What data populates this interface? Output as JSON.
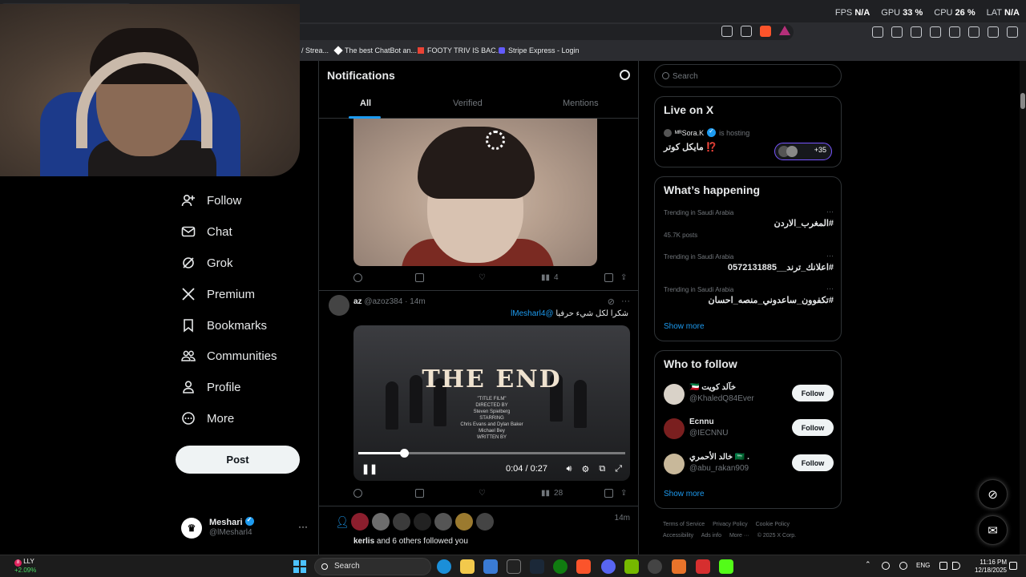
{
  "overlay": {
    "fps_label": "FPS",
    "fps_value": "N/A",
    "gpu_label": "GPU",
    "gpu_value": "33 %",
    "cpu_label": "CPU",
    "cpu_value": "26 %",
    "lat_label": "LAT",
    "lat_value": "N/A"
  },
  "bookmarks": [
    {
      "label": "/ Strea..."
    },
    {
      "label": "The best ChatBot an..."
    },
    {
      "label": "FOOTY TRIV IS BAC..."
    },
    {
      "label": "Stripe Express - Login"
    }
  ],
  "nav": {
    "items": [
      {
        "label": "Follow",
        "icon": "person-plus-icon"
      },
      {
        "label": "Chat",
        "icon": "mail-icon"
      },
      {
        "label": "Grok",
        "icon": "grok-icon"
      },
      {
        "label": "Premium",
        "icon": "x-logo-icon"
      },
      {
        "label": "Bookmarks",
        "icon": "bookmark-icon"
      },
      {
        "label": "Communities",
        "icon": "people-icon"
      },
      {
        "label": "Profile",
        "icon": "person-icon"
      },
      {
        "label": "More",
        "icon": "more-circle-icon"
      }
    ],
    "post_label": "Post"
  },
  "account": {
    "name": "Meshari",
    "handle": "@lMesharl4",
    "more": "···"
  },
  "notifications": {
    "title": "Notifications",
    "tabs": [
      "All",
      "Verified",
      "Mentions"
    ],
    "post1": {
      "views": "4"
    },
    "tweet": {
      "name": "az",
      "handle": "@azoz384",
      "time": "14m",
      "text": "شكرا لكل شيء حرفيا",
      "mention": "@lMesharl4",
      "video_title": "THE END",
      "video_credits": [
        "\"TITLE FILM\"",
        "DIRECTED BY",
        "Steven Spielberg",
        "STARRING",
        "Chris Evans and Dylan Baker",
        "Michael Bey",
        "WRITTEN BY"
      ],
      "time_current": "0:04",
      "time_total": "0:27",
      "progress": 0.17,
      "views": "28"
    },
    "follow_notice": {
      "time": "14m",
      "who": "kerlis",
      "rest": "and 6 others followed you"
    }
  },
  "search": {
    "placeholder": "Search"
  },
  "live": {
    "title": "Live on X",
    "host": "ᴹᴿSora.K",
    "hosting": "is hosting",
    "space_title": "مايكل كوتر ⁉️",
    "count": "+35"
  },
  "happening": {
    "title": "What’s happening",
    "trends": [
      {
        "context": "Trending in Saudi Arabia",
        "name": "#المغرب_الاردن",
        "count": "45.7K posts"
      },
      {
        "context": "Trending in Saudi Arabia",
        "name": "#اعلانك_ترند__0572131885",
        "count": ""
      },
      {
        "context": "Trending in Saudi Arabia",
        "name": "#تكفوون_ساعدوني_منصه_احسان",
        "count": ""
      }
    ],
    "show_more": "Show more"
  },
  "who_to_follow": {
    "title": "Who to follow",
    "users": [
      {
        "name": "🇰🇼 خآلد كويت",
        "handle": "@KhaledQ84Ever",
        "button": "Follow"
      },
      {
        "name": "Ecnnu",
        "handle": "@IECNNU",
        "button": "Follow"
      },
      {
        "name": "خالد الأحمري 🇸🇦 .",
        "handle": "@abu_rakan909",
        "button": "Follow"
      }
    ],
    "show_more": "Show more"
  },
  "footer": [
    "Terms of Service",
    "Privacy Policy",
    "Cookie Policy",
    "Accessibility",
    "Ads info",
    "More ···",
    "© 2025 X Corp."
  ],
  "taskbar": {
    "stock_name": "LLY",
    "stock_change": "+2.09%",
    "stock_badge": "8",
    "search_label": "Search",
    "lang": "ENG",
    "time": "11:16 PM",
    "date": "12/18/2025"
  },
  "colors": {
    "accent": "#1d9bf0",
    "background": "#000000",
    "purple": "#7856ff"
  }
}
